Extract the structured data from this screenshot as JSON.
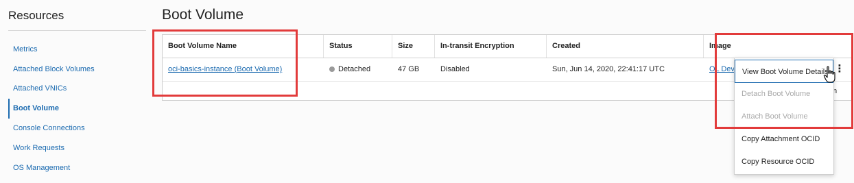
{
  "sidebar": {
    "title": "Resources",
    "items": [
      {
        "label": "Metrics"
      },
      {
        "label": "Attached Block Volumes"
      },
      {
        "label": "Attached VNICs"
      },
      {
        "label": "Boot Volume",
        "active": true
      },
      {
        "label": "Console Connections"
      },
      {
        "label": "Work Requests"
      },
      {
        "label": "OS Management"
      }
    ]
  },
  "main": {
    "title": "Boot Volume",
    "table": {
      "columns": [
        "Boot Volume Name",
        "Status",
        "Size",
        "In-transit Encryption",
        "Created",
        "Image"
      ],
      "rows": [
        {
          "name": "oci-basics-instance (Boot Volume)",
          "status": "Detached",
          "size": "47 GB",
          "encryption": "Disabled",
          "created": "Sun, Jun 14, 2020, 22:41:17 UTC",
          "image": "OL Dev"
        }
      ],
      "footer_fragment": "m"
    },
    "actions_menu": {
      "kebab_icon": "⋮",
      "items": [
        {
          "label": "View Boot Volume Details",
          "disabled": false
        },
        {
          "label": "Detach Boot Volume",
          "disabled": true
        },
        {
          "label": "Attach Boot Volume",
          "disabled": true
        },
        {
          "label": "Copy Attachment OCID",
          "disabled": false
        },
        {
          "label": "Copy Resource OCID",
          "disabled": false
        }
      ]
    }
  },
  "colors": {
    "link": "#1c6bb0",
    "highlight": "#e23b3b",
    "status_detached": "#9a9a9a"
  },
  "icons": {
    "cursor": "hand-pointer-icon",
    "kebab": "kebab-menu-icon",
    "status": "status-dot-icon"
  }
}
